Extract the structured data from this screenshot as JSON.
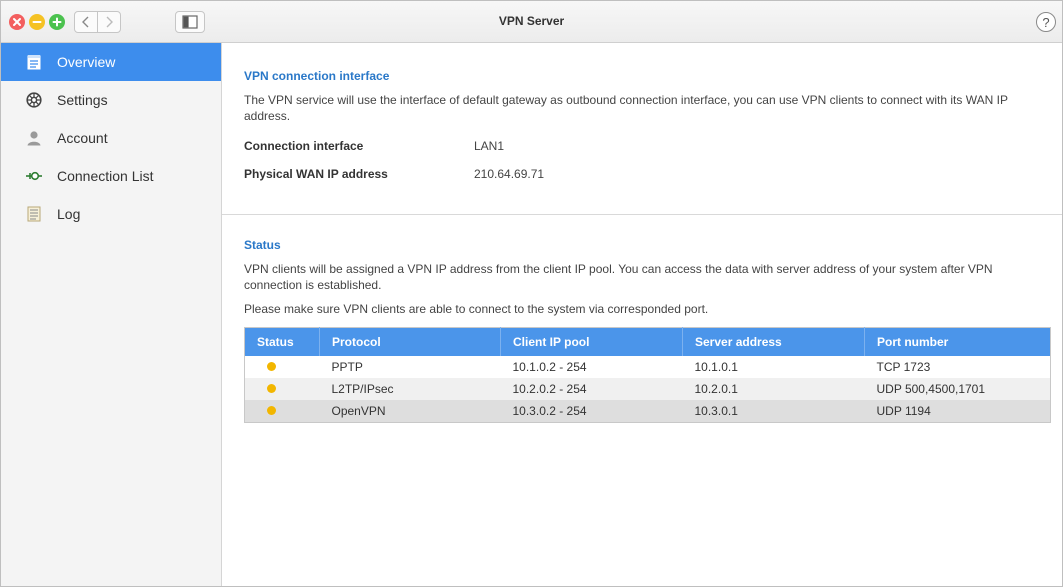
{
  "window": {
    "title": "VPN Server",
    "help_label": "?"
  },
  "sidebar": {
    "items": [
      {
        "label": "Overview",
        "icon": "overview-icon",
        "active": true
      },
      {
        "label": "Settings",
        "icon": "gear-icon",
        "active": false
      },
      {
        "label": "Account",
        "icon": "user-icon",
        "active": false
      },
      {
        "label": "Connection List",
        "icon": "connection-icon",
        "active": false
      },
      {
        "label": "Log",
        "icon": "log-icon",
        "active": false
      }
    ]
  },
  "interface": {
    "title": "VPN connection interface",
    "description": "The VPN service will use the interface of default gateway as outbound connection interface, you can use VPN clients to connect with its WAN IP address.",
    "fields": [
      {
        "label": "Connection interface",
        "value": "LAN1"
      },
      {
        "label": "Physical WAN IP address",
        "value": "210.64.69.71"
      }
    ]
  },
  "status": {
    "title": "Status",
    "description": "VPN clients will be assigned a VPN IP address from the client IP pool. You can access the data with server address of your system after VPN connection is established.",
    "note": "Please make sure VPN clients are able to connect to the system via corresponded port.",
    "columns": [
      "Status",
      "Protocol",
      "Client IP pool",
      "Server address",
      "Port number"
    ],
    "rows": [
      {
        "status_color": "#f2b600",
        "protocol": "PPTP",
        "pool": "10.1.0.2 - 254",
        "server": "10.1.0.1",
        "port": "TCP 1723"
      },
      {
        "status_color": "#f2b600",
        "protocol": "L2TP/IPsec",
        "pool": "10.2.0.2 - 254",
        "server": "10.2.0.1",
        "port": "UDP 500,4500,1701"
      },
      {
        "status_color": "#f2b600",
        "protocol": "OpenVPN",
        "pool": "10.3.0.2 - 254",
        "server": "10.3.0.1",
        "port": "UDP 1194"
      }
    ]
  },
  "colors": {
    "accent": "#3d8ded",
    "header": "#4b95ea",
    "title_blue": "#2a78c8",
    "status_dot": "#f2b600"
  }
}
